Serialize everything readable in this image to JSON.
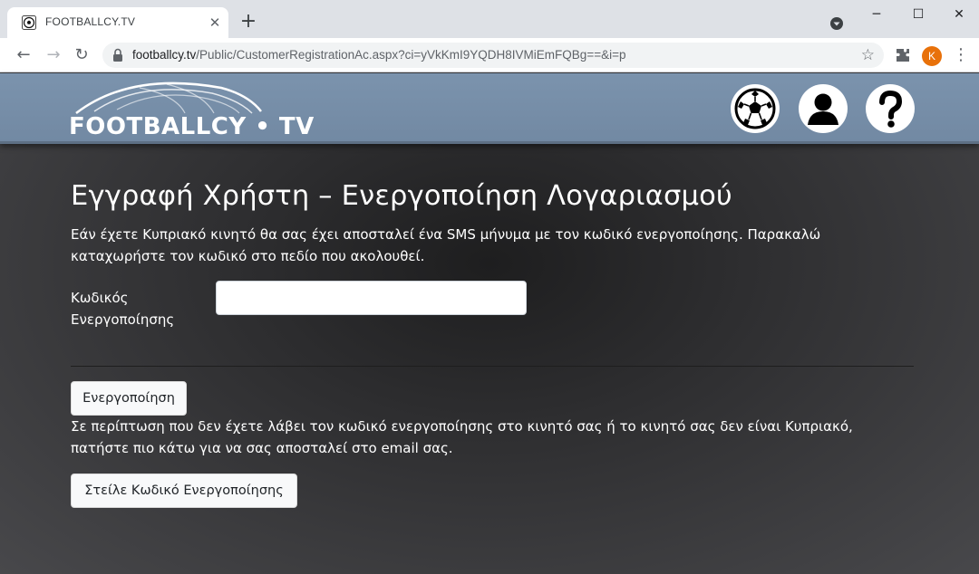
{
  "browser": {
    "tab_title": "FOOTBALLCY.TV",
    "tab_close": "✕",
    "new_tab": "+",
    "url_host": "footballcy.tv",
    "url_path": "/Public/CustomerRegistrationAc.aspx?ci=yVkKmI9YQDH8IVMiEmFQBg==&i=p",
    "profile_initial": "K",
    "back": "←",
    "forward": "→",
    "reload": "↻",
    "star": "☆",
    "menu": "⋮",
    "minimize": "─",
    "maximize": "☐",
    "close": "✕"
  },
  "header": {
    "logo_text": "FOOTBALLCY • TV",
    "icons": [
      "football-icon",
      "user-icon",
      "help-icon"
    ]
  },
  "main": {
    "title": "Εγγραφή Χρήστη – Ενεργοποίηση Λογαριασμού",
    "intro": "Εάν έχετε Κυπριακό κινητό θα σας έχει αποσταλεί ένα SMS μήνυμα με τον κωδικό ενεργοποίησης. Παρακαλώ καταχωρήστε τον κωδικό στο πεδίο που ακολουθεί.",
    "code_label": "Κωδικός Ενεργοποίησης",
    "code_value": "",
    "activate_button": "Ενεργοποίηση",
    "note": "Σε περίπτωση που δεν έχετε λάβει τον κωδικό ενεργοποίησης στο κινητό σας ή το κινητό σας δεν είναι Κυπριακό, πατήστε πιο κάτω για να σας αποσταλεί στο email σας.",
    "send_button": "Στείλε Κωδικό Ενεργοποίησης"
  },
  "colors": {
    "header_bg": "#7b93ad",
    "page_bg": "#2d2d2f",
    "profile": "#e8710a"
  }
}
